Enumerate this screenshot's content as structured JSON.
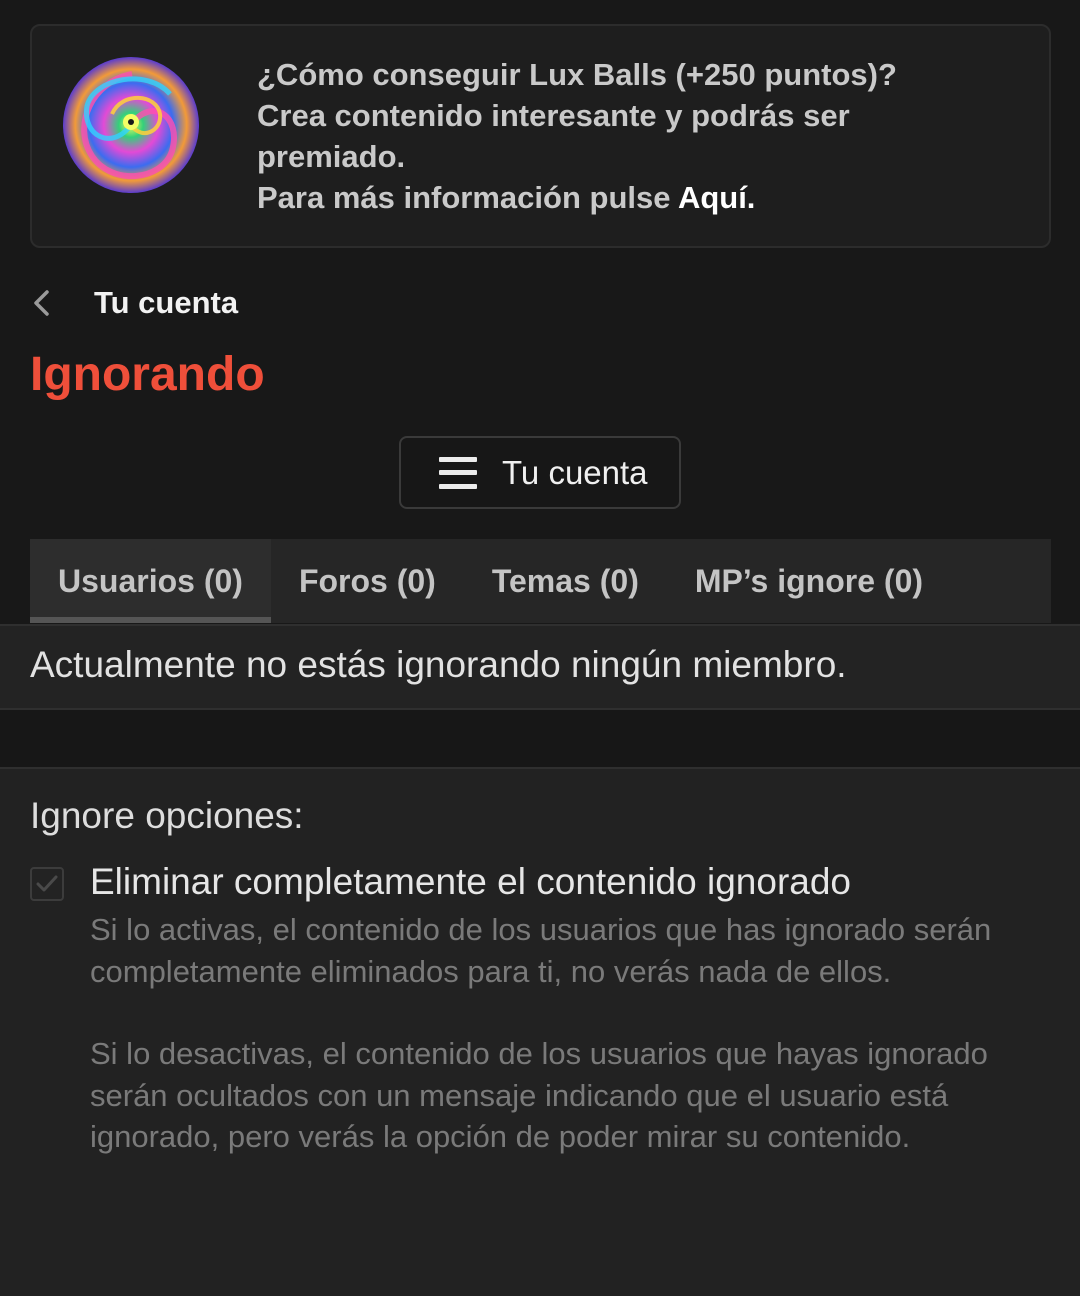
{
  "notice": {
    "line1": "¿Cómo conseguir Lux Balls (+250 puntos)?",
    "line2": "Crea contenido interesante y podrás ser",
    "line3": "premiado.",
    "line4_prefix": "Para más información pulse ",
    "link_label": "Aquí."
  },
  "breadcrumb": {
    "label": "Tu cuenta",
    "icon": "chevron-left-icon"
  },
  "page": {
    "title": "Ignorando",
    "accent_color": "#ef4f3a"
  },
  "menu_button": {
    "label": "Tu cuenta",
    "icon": "hamburger-menu-icon"
  },
  "tabs": [
    {
      "label": "Usuarios (0)",
      "active": true
    },
    {
      "label": "Foros (0)",
      "active": false
    },
    {
      "label": "Temas (0)",
      "active": false
    },
    {
      "label": "MP’s ignore (0)",
      "active": false
    }
  ],
  "empty_message": "Actualmente no estás ignorando ningún miembro.",
  "options": {
    "heading": "Ignore opciones:",
    "item": {
      "title": "Eliminar completamente el contenido ignorado",
      "checked": true,
      "desc1": "Si lo activas, el contenido de los usuarios que has ignorado serán completamente eliminados para ti, no verás nada de ellos.",
      "desc2": "Si lo desactivas, el contenido de los usuarios que hayas ignorado serán ocultados con un mensaje indicando que el usuario está ignorado, pero verás la opción de poder mirar su contenido."
    }
  }
}
